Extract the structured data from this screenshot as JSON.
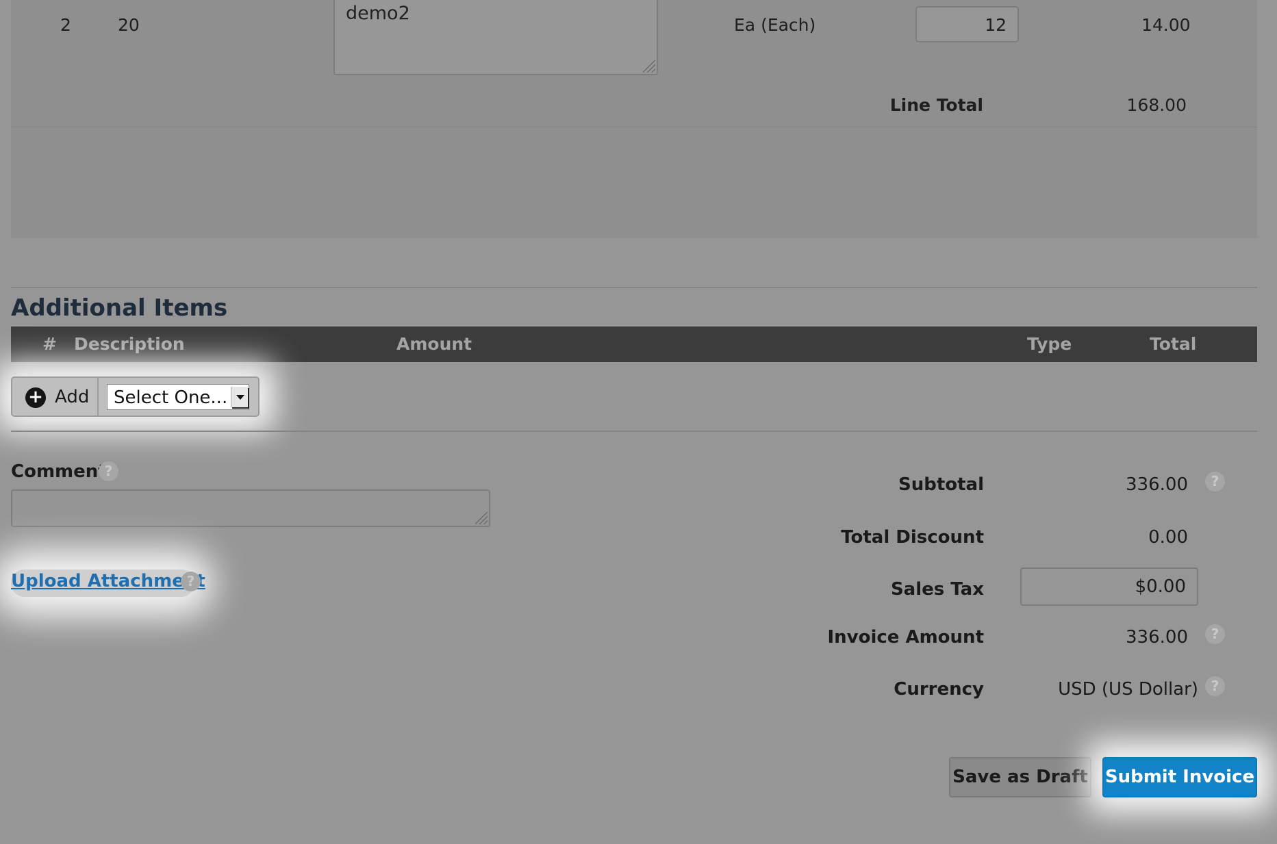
{
  "line_item": {
    "number": "2",
    "code": "20",
    "description": "demo2",
    "unit": "Ea (Each)",
    "quantity": "12",
    "price": "14.00",
    "line_total_label": "Line Total",
    "line_total_value": "168.00"
  },
  "additional_items": {
    "title": "Additional Items",
    "columns": [
      "#",
      "Description",
      "Amount",
      "Type",
      "Total"
    ],
    "add_label": "Add",
    "select_value": "Select One..."
  },
  "comment": {
    "label": "Comment",
    "help_icon": "question-icon"
  },
  "upload": {
    "label": "Upload Attachment"
  },
  "summary": {
    "subtotal_label": "Subtotal",
    "subtotal_value": "336.00",
    "discount_label": "Total Discount",
    "discount_value": "0.00",
    "tax_label": "Sales Tax",
    "tax_value": "$0.00",
    "invoice_label": "Invoice Amount",
    "invoice_value": "336.00",
    "currency_label": "Currency",
    "currency_value": "USD (US Dollar)"
  },
  "actions": {
    "draft_label": "Save as Draft",
    "submit_label": "Submit Invoice"
  },
  "colors": {
    "accent": "#1283c7",
    "link": "#1f6fb0",
    "header_bar": "#3c3c3c"
  }
}
